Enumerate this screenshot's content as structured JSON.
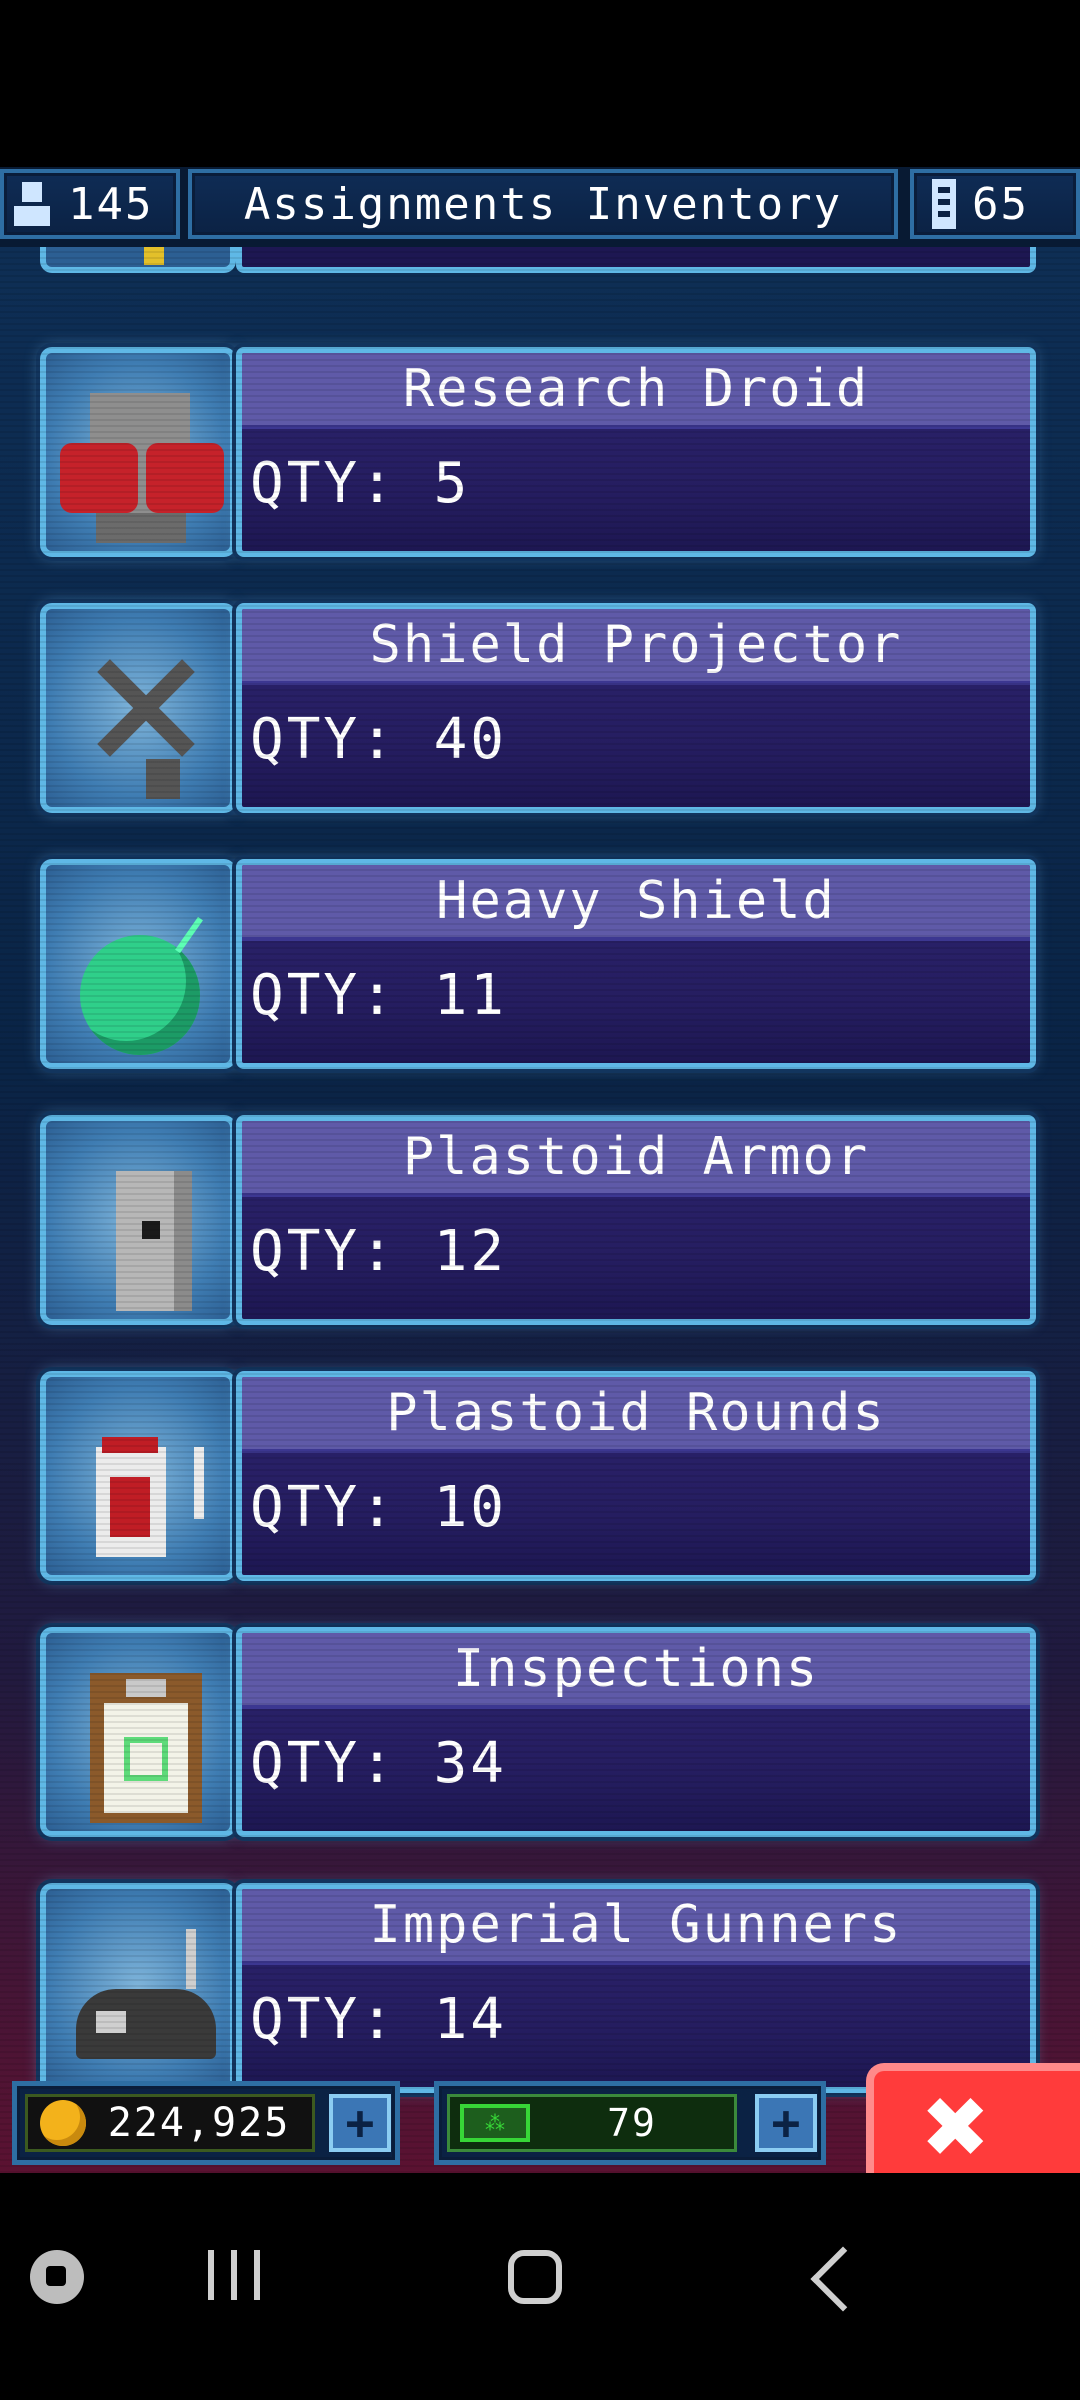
{
  "header": {
    "crew_count": "145",
    "title": "Assignments Inventory",
    "device_count": "65"
  },
  "inventory": [
    {
      "name": "Research Droid",
      "qty": "QTY: 5",
      "icon": "research-droid-icon"
    },
    {
      "name": "Shield Projector",
      "qty": "QTY: 40",
      "icon": "shield-projector-icon"
    },
    {
      "name": "Heavy Shield",
      "qty": "QTY: 11",
      "icon": "heavy-shield-icon"
    },
    {
      "name": "Plastoid Armor",
      "qty": "QTY: 12",
      "icon": "plastoid-armor-icon"
    },
    {
      "name": "Plastoid Rounds",
      "qty": "QTY: 10",
      "icon": "plastoid-rounds-icon"
    },
    {
      "name": "Inspections",
      "qty": "QTY: 34",
      "icon": "inspections-icon"
    },
    {
      "name": "Imperial Gunners",
      "qty": "QTY: 14",
      "icon": "imperial-gunners-icon"
    }
  ],
  "bottom_bar": {
    "credits": "224,925",
    "energy": "79",
    "plus_symbol": "+",
    "close_symbol": "✖"
  },
  "colors": {
    "panel_border": "#5fb8e6",
    "panel_title_bg": "#5f5aa8",
    "panel_body_bg": "#251d60",
    "close_button": "#ff3b3b",
    "coin": "#f3b21b",
    "energy": "#37d637"
  },
  "energy_icon_glyph": "⁂"
}
